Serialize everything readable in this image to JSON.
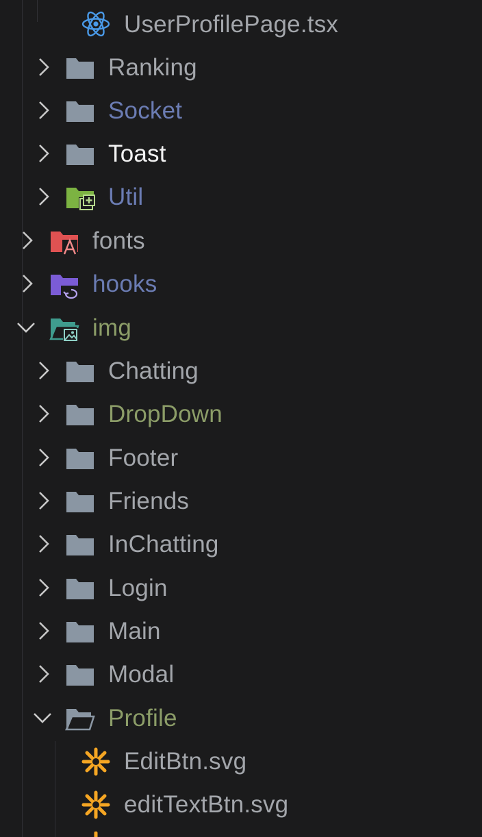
{
  "explorer": {
    "items": [
      {
        "label": "UserProfilePage.tsx",
        "icon": "react-icon",
        "chevron": "none",
        "color": "#a3a6ab"
      },
      {
        "label": "Ranking",
        "icon": "folder-icon",
        "chevron": "right",
        "color": "#a3a6ab"
      },
      {
        "label": "Socket",
        "icon": "folder-icon",
        "chevron": "right",
        "color": "#6b7cb3"
      },
      {
        "label": "Toast",
        "icon": "folder-icon",
        "chevron": "right",
        "color": "#f2f2f2"
      },
      {
        "label": "Util",
        "icon": "folder-util-icon",
        "chevron": "right",
        "color": "#6b7cb3"
      },
      {
        "label": "fonts",
        "icon": "folder-font-icon",
        "chevron": "right",
        "color": "#a3a6ab"
      },
      {
        "label": "hooks",
        "icon": "folder-hooks-icon",
        "chevron": "right",
        "color": "#6b7cb3"
      },
      {
        "label": "img",
        "icon": "folder-images-open-icon",
        "chevron": "down",
        "color": "#8c9d68"
      },
      {
        "label": "Chatting",
        "icon": "folder-icon",
        "chevron": "right",
        "color": "#a3a6ab"
      },
      {
        "label": "DropDown",
        "icon": "folder-icon",
        "chevron": "right",
        "color": "#8c9d68"
      },
      {
        "label": "Footer",
        "icon": "folder-icon",
        "chevron": "right",
        "color": "#a3a6ab"
      },
      {
        "label": "Friends",
        "icon": "folder-icon",
        "chevron": "right",
        "color": "#a3a6ab"
      },
      {
        "label": "InChatting",
        "icon": "folder-icon",
        "chevron": "right",
        "color": "#a3a6ab"
      },
      {
        "label": "Login",
        "icon": "folder-icon",
        "chevron": "right",
        "color": "#a3a6ab"
      },
      {
        "label": "Main",
        "icon": "folder-icon",
        "chevron": "right",
        "color": "#a3a6ab"
      },
      {
        "label": "Modal",
        "icon": "folder-icon",
        "chevron": "right",
        "color": "#a3a6ab"
      },
      {
        "label": "Profile",
        "icon": "folder-open-icon",
        "chevron": "down",
        "color": "#8c9d68"
      },
      {
        "label": "EditBtn.svg",
        "icon": "svg-file-icon",
        "chevron": "none",
        "color": "#a3a6ab"
      },
      {
        "label": "editTextBtn.svg",
        "icon": "svg-file-icon",
        "chevron": "none",
        "color": "#a3a6ab"
      }
    ]
  },
  "colors": {
    "background": "#1b1b1c",
    "folder": "#8a96a3",
    "react": "#4a9ae8",
    "svg_star": "#f5a623",
    "font_folder": "#e05252",
    "hooks_folder": "#7b5cd6",
    "util_folder": "#7cb342",
    "img_folder": "#3f9c8e"
  }
}
